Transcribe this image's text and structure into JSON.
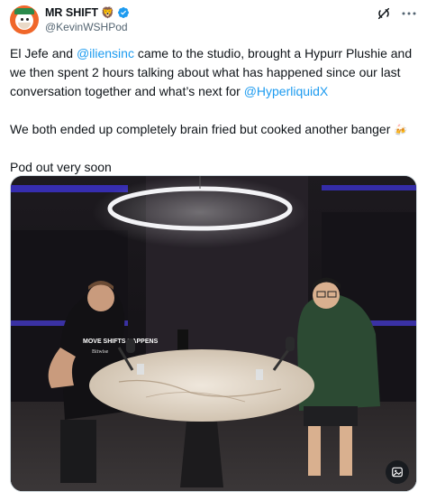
{
  "author": {
    "display_name": "MR SHIFT",
    "name_emoji": "🦁",
    "handle": "@KevinWSHPod"
  },
  "post": {
    "p1_a": "El Jefe and ",
    "p1_mention1": "@iliensinc",
    "p1_b": " came to the studio, brought a Hypurr Plushie and we then spent 2 hours talking about what has happened since our last conversation together and what’s next for ",
    "p1_mention2": "@HyperliquidX",
    "p2_text": "We both ended up completely brain fried but cooked another banger ",
    "p2_emoji": "🍻",
    "p3_text": "Pod out very soon"
  },
  "media": {
    "shirt_text": "MOVE SHIFTS HAPPENS",
    "shirt_sub": "Bitwise"
  },
  "icons": {
    "verified": "verified-badge-icon",
    "grok": "grok-icon",
    "more": "more-options-icon",
    "alt": "image-alt-icon"
  },
  "colors": {
    "link": "#1d9bf0",
    "verified": "#1d9bf0",
    "avatar": "#f0672a"
  }
}
